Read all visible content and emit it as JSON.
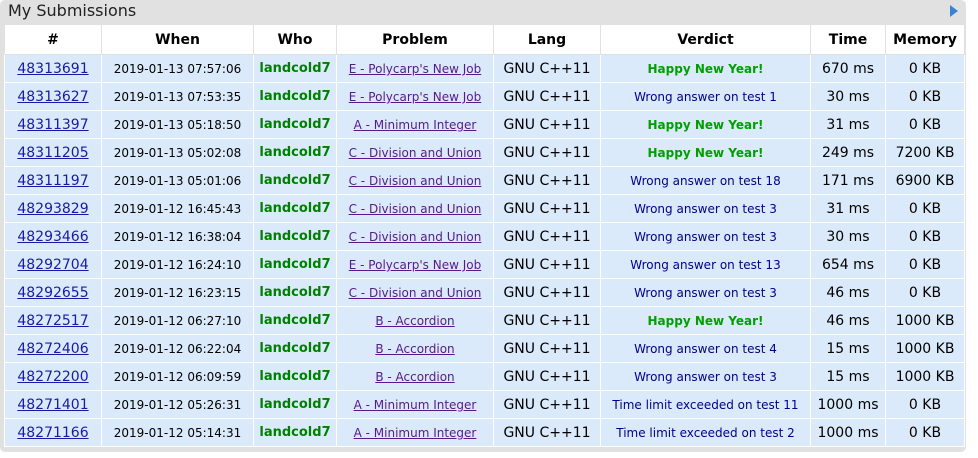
{
  "header": {
    "title": "My Submissions",
    "nav_icon": "play-arrow-icon"
  },
  "table": {
    "columns": [
      "#",
      "When",
      "Who",
      "Problem",
      "Lang",
      "Verdict",
      "Time",
      "Memory"
    ],
    "rows": [
      {
        "id": "48313691",
        "when": "2019-01-13 07:57:06",
        "who": "landcold7",
        "problem": "E - Polycarp's New Job",
        "lang": "GNU C++11",
        "verdict": "Happy New Year!",
        "accepted": true,
        "time": "670 ms",
        "memory": "0 KB"
      },
      {
        "id": "48313627",
        "when": "2019-01-13 07:53:35",
        "who": "landcold7",
        "problem": "E - Polycarp's New Job",
        "lang": "GNU C++11",
        "verdict": "Wrong answer on test 1",
        "accepted": false,
        "time": "30 ms",
        "memory": "0 KB"
      },
      {
        "id": "48311397",
        "when": "2019-01-13 05:18:50",
        "who": "landcold7",
        "problem": "A - Minimum Integer",
        "lang": "GNU C++11",
        "verdict": "Happy New Year!",
        "accepted": true,
        "time": "31 ms",
        "memory": "0 KB"
      },
      {
        "id": "48311205",
        "when": "2019-01-13 05:02:08",
        "who": "landcold7",
        "problem": "C - Division and Union",
        "lang": "GNU C++11",
        "verdict": "Happy New Year!",
        "accepted": true,
        "time": "249 ms",
        "memory": "7200 KB"
      },
      {
        "id": "48311197",
        "when": "2019-01-13 05:01:06",
        "who": "landcold7",
        "problem": "C - Division and Union",
        "lang": "GNU C++11",
        "verdict": "Wrong answer on test 18",
        "accepted": false,
        "time": "171 ms",
        "memory": "6900 KB"
      },
      {
        "id": "48293829",
        "when": "2019-01-12 16:45:43",
        "who": "landcold7",
        "problem": "C - Division and Union",
        "lang": "GNU C++11",
        "verdict": "Wrong answer on test 3",
        "accepted": false,
        "time": "31 ms",
        "memory": "0 KB"
      },
      {
        "id": "48293466",
        "when": "2019-01-12 16:38:04",
        "who": "landcold7",
        "problem": "C - Division and Union",
        "lang": "GNU C++11",
        "verdict": "Wrong answer on test 3",
        "accepted": false,
        "time": "30 ms",
        "memory": "0 KB"
      },
      {
        "id": "48292704",
        "when": "2019-01-12 16:24:10",
        "who": "landcold7",
        "problem": "E - Polycarp's New Job",
        "lang": "GNU C++11",
        "verdict": "Wrong answer on test 13",
        "accepted": false,
        "time": "654 ms",
        "memory": "0 KB"
      },
      {
        "id": "48292655",
        "when": "2019-01-12 16:23:15",
        "who": "landcold7",
        "problem": "C - Division and Union",
        "lang": "GNU C++11",
        "verdict": "Wrong answer on test 3",
        "accepted": false,
        "time": "46 ms",
        "memory": "0 KB"
      },
      {
        "id": "48272517",
        "when": "2019-01-12 06:27:10",
        "who": "landcold7",
        "problem": "B - Accordion",
        "lang": "GNU C++11",
        "verdict": "Happy New Year!",
        "accepted": true,
        "time": "46 ms",
        "memory": "1000 KB"
      },
      {
        "id": "48272406",
        "when": "2019-01-12 06:22:04",
        "who": "landcold7",
        "problem": "B - Accordion",
        "lang": "GNU C++11",
        "verdict": "Wrong answer on test 4",
        "accepted": false,
        "time": "15 ms",
        "memory": "1000 KB"
      },
      {
        "id": "48272200",
        "when": "2019-01-12 06:09:59",
        "who": "landcold7",
        "problem": "B - Accordion",
        "lang": "GNU C++11",
        "verdict": "Wrong answer on test 3",
        "accepted": false,
        "time": "15 ms",
        "memory": "1000 KB"
      },
      {
        "id": "48271401",
        "when": "2019-01-12 05:26:31",
        "who": "landcold7",
        "problem": "A - Minimum Integer",
        "lang": "GNU C++11",
        "verdict": "Time limit exceeded on test 11",
        "accepted": false,
        "time": "1000 ms",
        "memory": "0 KB"
      },
      {
        "id": "48271166",
        "when": "2019-01-12 05:14:31",
        "who": "landcold7",
        "problem": "A - Minimum Integer",
        "lang": "GNU C++11",
        "verdict": "Time limit exceeded on test 2",
        "accepted": false,
        "time": "1000 ms",
        "memory": "0 KB"
      }
    ]
  },
  "colors": {
    "accepted": "#00a000",
    "rejected": "#00008b",
    "row_bg": "#dbeafa",
    "panel_bg": "#e1e1e1"
  }
}
